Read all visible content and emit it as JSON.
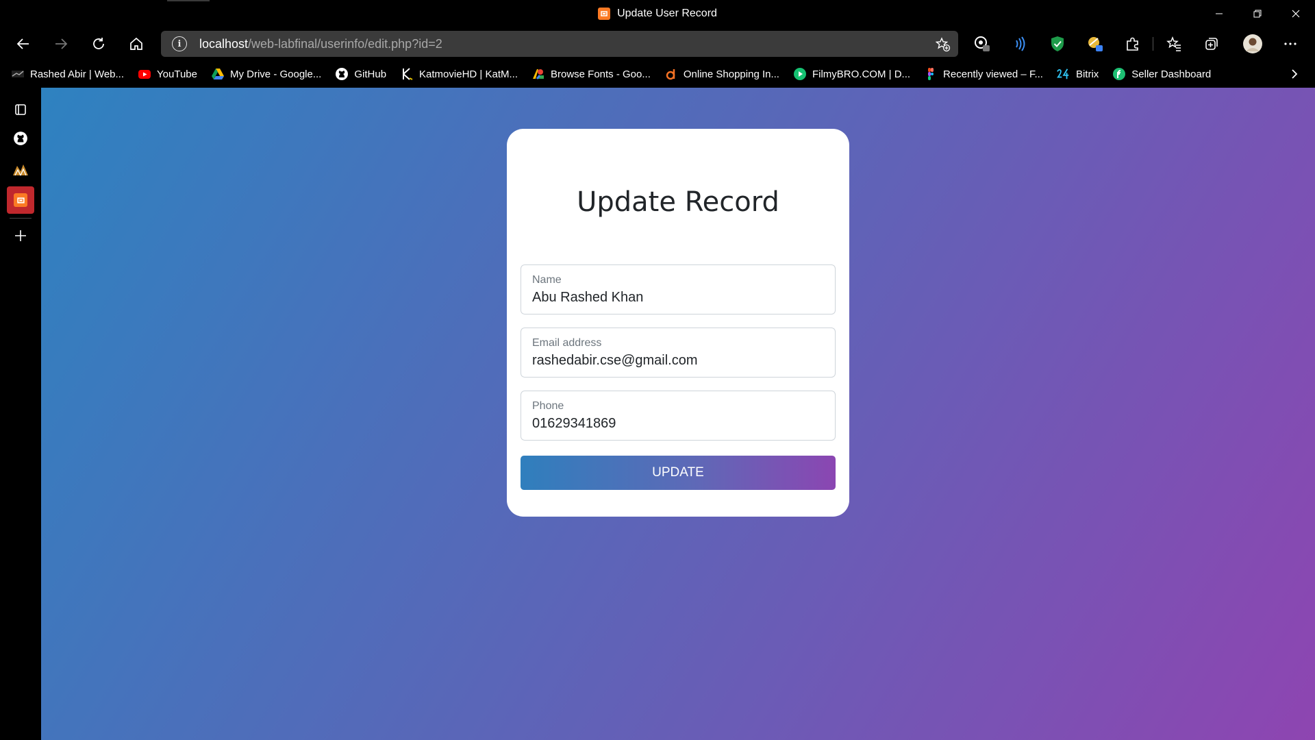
{
  "window": {
    "title": "Update User Record"
  },
  "nav": {
    "url_host": "localhost",
    "url_path": "/web-labfinal/userinfo/edit.php?id=2"
  },
  "bookmarks": [
    {
      "label": "Rashed Abir | Web...",
      "icon": "rashed-abir-favicon"
    },
    {
      "label": "YouTube",
      "icon": "youtube-icon"
    },
    {
      "label": "My Drive - Google...",
      "icon": "google-drive-icon"
    },
    {
      "label": "GitHub",
      "icon": "github-icon"
    },
    {
      "label": "KatmovieHD | KatM...",
      "icon": "katmovie-icon"
    },
    {
      "label": "Browse Fonts - Goo...",
      "icon": "google-fonts-icon"
    },
    {
      "label": "Online Shopping In...",
      "icon": "daraz-icon"
    },
    {
      "label": "FilmyBRO.COM | D...",
      "icon": "filmybro-icon"
    },
    {
      "label": "Recently viewed – F...",
      "icon": "figma-icon"
    },
    {
      "label": "Bitrix",
      "icon": "bitrix24-icon"
    },
    {
      "label": "Seller Dashboard",
      "icon": "fiverr-icon"
    }
  ],
  "form": {
    "heading": "Update Record",
    "fields": [
      {
        "label": "Name",
        "value": "Abu Rashed Khan"
      },
      {
        "label": "Email address",
        "value": "rashedabir.cse@gmail.com"
      },
      {
        "label": "Phone",
        "value": "01629341869"
      }
    ],
    "submit_label": "UPDATE"
  },
  "colors": {
    "gradient_start": "#2e82c0",
    "gradient_end": "#8e45b1",
    "card_bg": "#ffffff",
    "xampp_orange": "#fb7a24"
  }
}
